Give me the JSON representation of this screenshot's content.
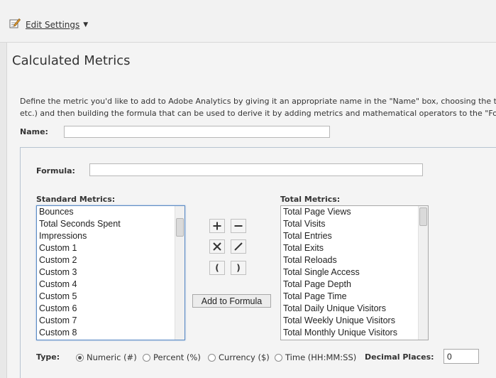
{
  "header": {
    "edit_settings_label": "Edit Settings"
  },
  "page": {
    "title": "Calculated Metrics",
    "description_line1": "Define the metric you'd like to add to Adobe Analytics by giving it an appropriate name in the \"Name\" box, choosing the type of m",
    "description_line2": "etc.) and then building the formula that can be used to derive it by adding metrics and mathematical operators to the \"Formula\" bo"
  },
  "form": {
    "name_label": "Name:",
    "name_value": "",
    "formula_label": "Formula:",
    "formula_value": ""
  },
  "standard_metrics": {
    "title": "Standard Metrics:",
    "items": [
      "Bounces",
      "Total Seconds Spent",
      "Impressions",
      "Custom 1",
      "Custom 2",
      "Custom 3",
      "Custom 4",
      "Custom 5",
      "Custom 6",
      "Custom 7",
      "Custom 8"
    ]
  },
  "total_metrics": {
    "title": "Total Metrics:",
    "items": [
      "Total Page Views",
      "Total Visits",
      "Total Entries",
      "Total Exits",
      "Total Reloads",
      "Total Single Access",
      "Total Page Depth",
      "Total Page Time",
      "Total Daily Unique Visitors",
      "Total Weekly Unique Visitors",
      "Total Monthly Unique Visitors"
    ]
  },
  "operators": {
    "open_paren": "(",
    "close_paren": ")",
    "add_to_formula_label": "Add to Formula"
  },
  "type": {
    "label": "Type:",
    "options": [
      "Numeric (#)",
      "Percent (%)",
      "Currency ($)",
      "Time (HH:MM:SS)"
    ],
    "selected": "Numeric (#)"
  },
  "decimal_places": {
    "label": "Decimal Places:",
    "value": "0"
  },
  "icons": {
    "edit": "edit-pencil-icon",
    "dropdown": "chevron-down-icon",
    "plus": "plus-icon",
    "minus": "minus-icon",
    "multiply": "multiply-icon",
    "divide": "divide-icon"
  },
  "colors": {
    "focus_border": "#5b8ac4",
    "panel_border": "#b7c3d1"
  }
}
